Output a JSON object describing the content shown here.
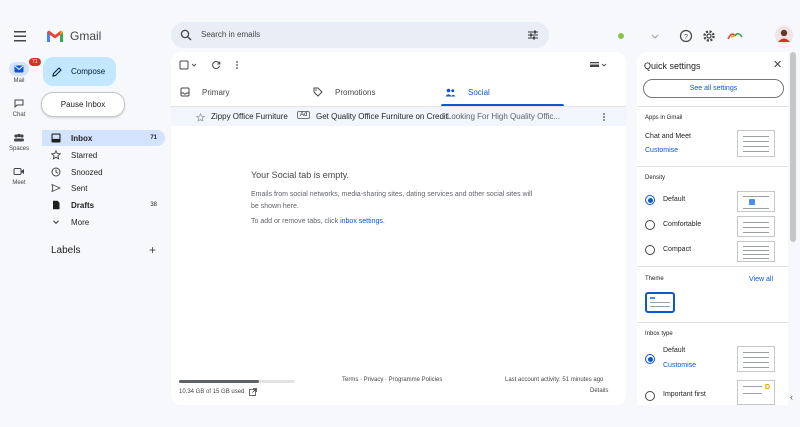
{
  "app": {
    "logo_text": "Gmail"
  },
  "search": {
    "placeholder": "Search in emails"
  },
  "rail": {
    "items": [
      {
        "label": "Mail",
        "badge": "71"
      },
      {
        "label": "Chat"
      },
      {
        "label": "Spaces"
      },
      {
        "label": "Meet"
      }
    ]
  },
  "sidebar": {
    "compose_label": "Compose",
    "pause_label": "Pause Inbox",
    "items": [
      {
        "label": "Inbox",
        "count": "71"
      },
      {
        "label": "Starred"
      },
      {
        "label": "Snoozed"
      },
      {
        "label": "Sent"
      },
      {
        "label": "Drafts",
        "count": "38"
      },
      {
        "label": "More"
      }
    ],
    "labels_title": "Labels",
    "labels_add": "+"
  },
  "tabs": [
    {
      "label": "Primary"
    },
    {
      "label": "Promotions"
    },
    {
      "label": "Social"
    }
  ],
  "email_row": {
    "sender": "Zippy Office Furniture",
    "ad_badge": "Ad",
    "subject": "Get Quality Office Furniture on Credit",
    "snippet": " - Looking For High Quality Offic..."
  },
  "empty_state": {
    "title": "Your Social tab is empty.",
    "text": "Emails from social networks, media-sharing sites, dating services and other social sites will be shown here.",
    "tabs_text_prefix": "To add or remove tabs, click ",
    "tabs_link": "inbox settings",
    "tabs_text_suffix": "."
  },
  "footer": {
    "storage_text": "10.34 GB of 15 GB used",
    "storage_fraction": 0.69,
    "links": "Terms · Privacy · Programme Policies",
    "activity": "Last account activity: 51 minutes ago",
    "details": "Details"
  },
  "quick_settings": {
    "title": "Quick settings",
    "see_all": "See all settings",
    "apps_section": "Apps in Gmail",
    "chat_meet": "Chat and Meet",
    "customise": "Customise",
    "density_section": "Density",
    "density_options": [
      "Default",
      "Comfortable",
      "Compact"
    ],
    "density_selected": "Default",
    "theme_section": "Theme",
    "view_all": "View all",
    "inbox_type_section": "Inbox type",
    "inbox_type_options": [
      "Default",
      "Important first"
    ],
    "inbox_customise": "Customise"
  },
  "colors": {
    "accent": "#0b57d0",
    "compose_bg": "#c2e7ff",
    "active_nav": "#d3e3fd",
    "badge": "#d93025"
  }
}
